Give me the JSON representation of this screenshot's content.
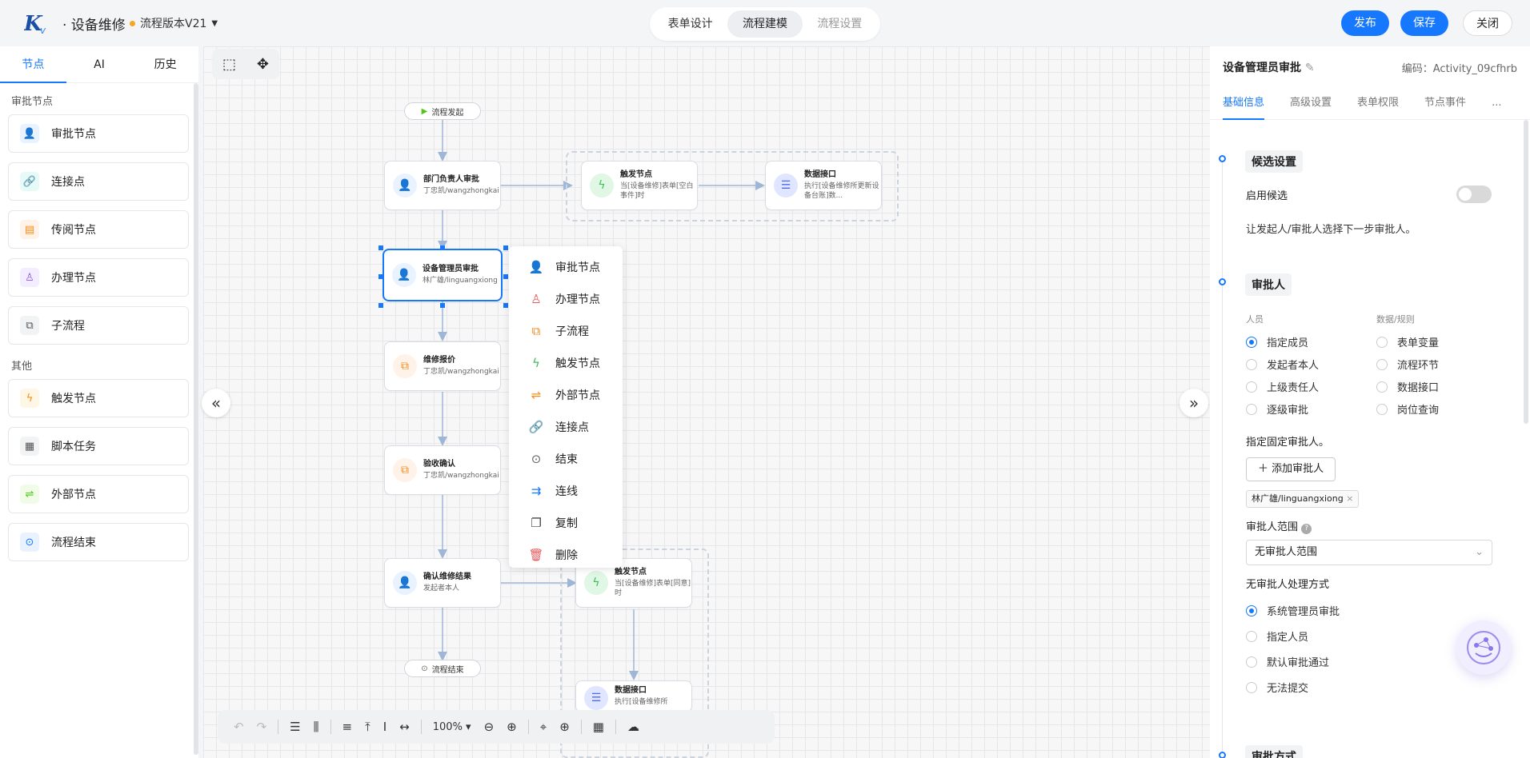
{
  "header": {
    "title": "· 设备维修",
    "version": "流程版本V21",
    "tabs": [
      "表单设计",
      "流程建模",
      "流程设置"
    ],
    "publish": "发布",
    "save": "保存",
    "close": "关闭"
  },
  "left": {
    "tabs": [
      "节点",
      "AI",
      "历史"
    ],
    "sec1": "审批节点",
    "items1": [
      "审批节点",
      "连接点",
      "传阅节点",
      "办理节点",
      "子流程"
    ],
    "sec2": "其他",
    "items2": [
      "触发节点",
      "脚本任务",
      "外部节点",
      "流程结束"
    ]
  },
  "canvas": {
    "start": "流程发起",
    "end": "流程结束",
    "n1": {
      "title": "部门负责人审批",
      "sub": "丁忠凯/wangzhongkai"
    },
    "n2": {
      "title": "设备管理员审批",
      "sub": "林广雄/linguangxiong"
    },
    "n3": {
      "title": "维修报价",
      "sub": "丁忠凯/wangzhongkai"
    },
    "n4": {
      "title": "验收确认",
      "sub": "丁忠凯/wangzhongkai"
    },
    "n5": {
      "title": "确认维修结果",
      "sub": "发起者本人"
    },
    "t1": {
      "title": "触发节点",
      "sub": "当[设备维修]表单[空白事件]时"
    },
    "d1": {
      "title": "数据接口",
      "sub": "执行[设备维修所更新设备台账]数..."
    },
    "t2": {
      "title": "触发节点",
      "sub": "当[设备维修]表单[同意]时"
    },
    "d2": {
      "title": "数据接口",
      "sub": "执行[设备维修所"
    }
  },
  "context_menu": [
    "审批节点",
    "办理节点",
    "子流程",
    "触发节点",
    "外部节点",
    "连接点",
    "结束",
    "连线",
    "复制",
    "删除"
  ],
  "toolbar": {
    "zoom": "100%"
  },
  "right": {
    "title": "设备管理员审批",
    "code": "编码：Activity_09cfhrb",
    "tabs": [
      "基础信息",
      "高级设置",
      "表单权限",
      "节点事件",
      "..."
    ],
    "s1": {
      "head": "候选设置",
      "toggle_label": "启用候选",
      "desc": "让发起人/审批人选择下一步审批人。"
    },
    "s2": {
      "head": "审批人",
      "col1": "人员",
      "col2": "数据/规则",
      "opts1": [
        "指定成员",
        "发起者本人",
        "上级责任人",
        "逐级审批"
      ],
      "opts2": [
        "表单变量",
        "流程环节",
        "数据接口",
        "岗位查询"
      ],
      "fixed": "指定固定审批人。",
      "add": "添加审批人",
      "tag": "林广雄/linguangxiong",
      "range_label": "审批人范围",
      "range_value": "无审批人范围",
      "no_label": "无审批人处理方式",
      "no_opts": [
        "系统管理员审批",
        "指定人员",
        "默认审批通过",
        "无法提交"
      ]
    },
    "s3": {
      "head": "审批方式"
    }
  }
}
